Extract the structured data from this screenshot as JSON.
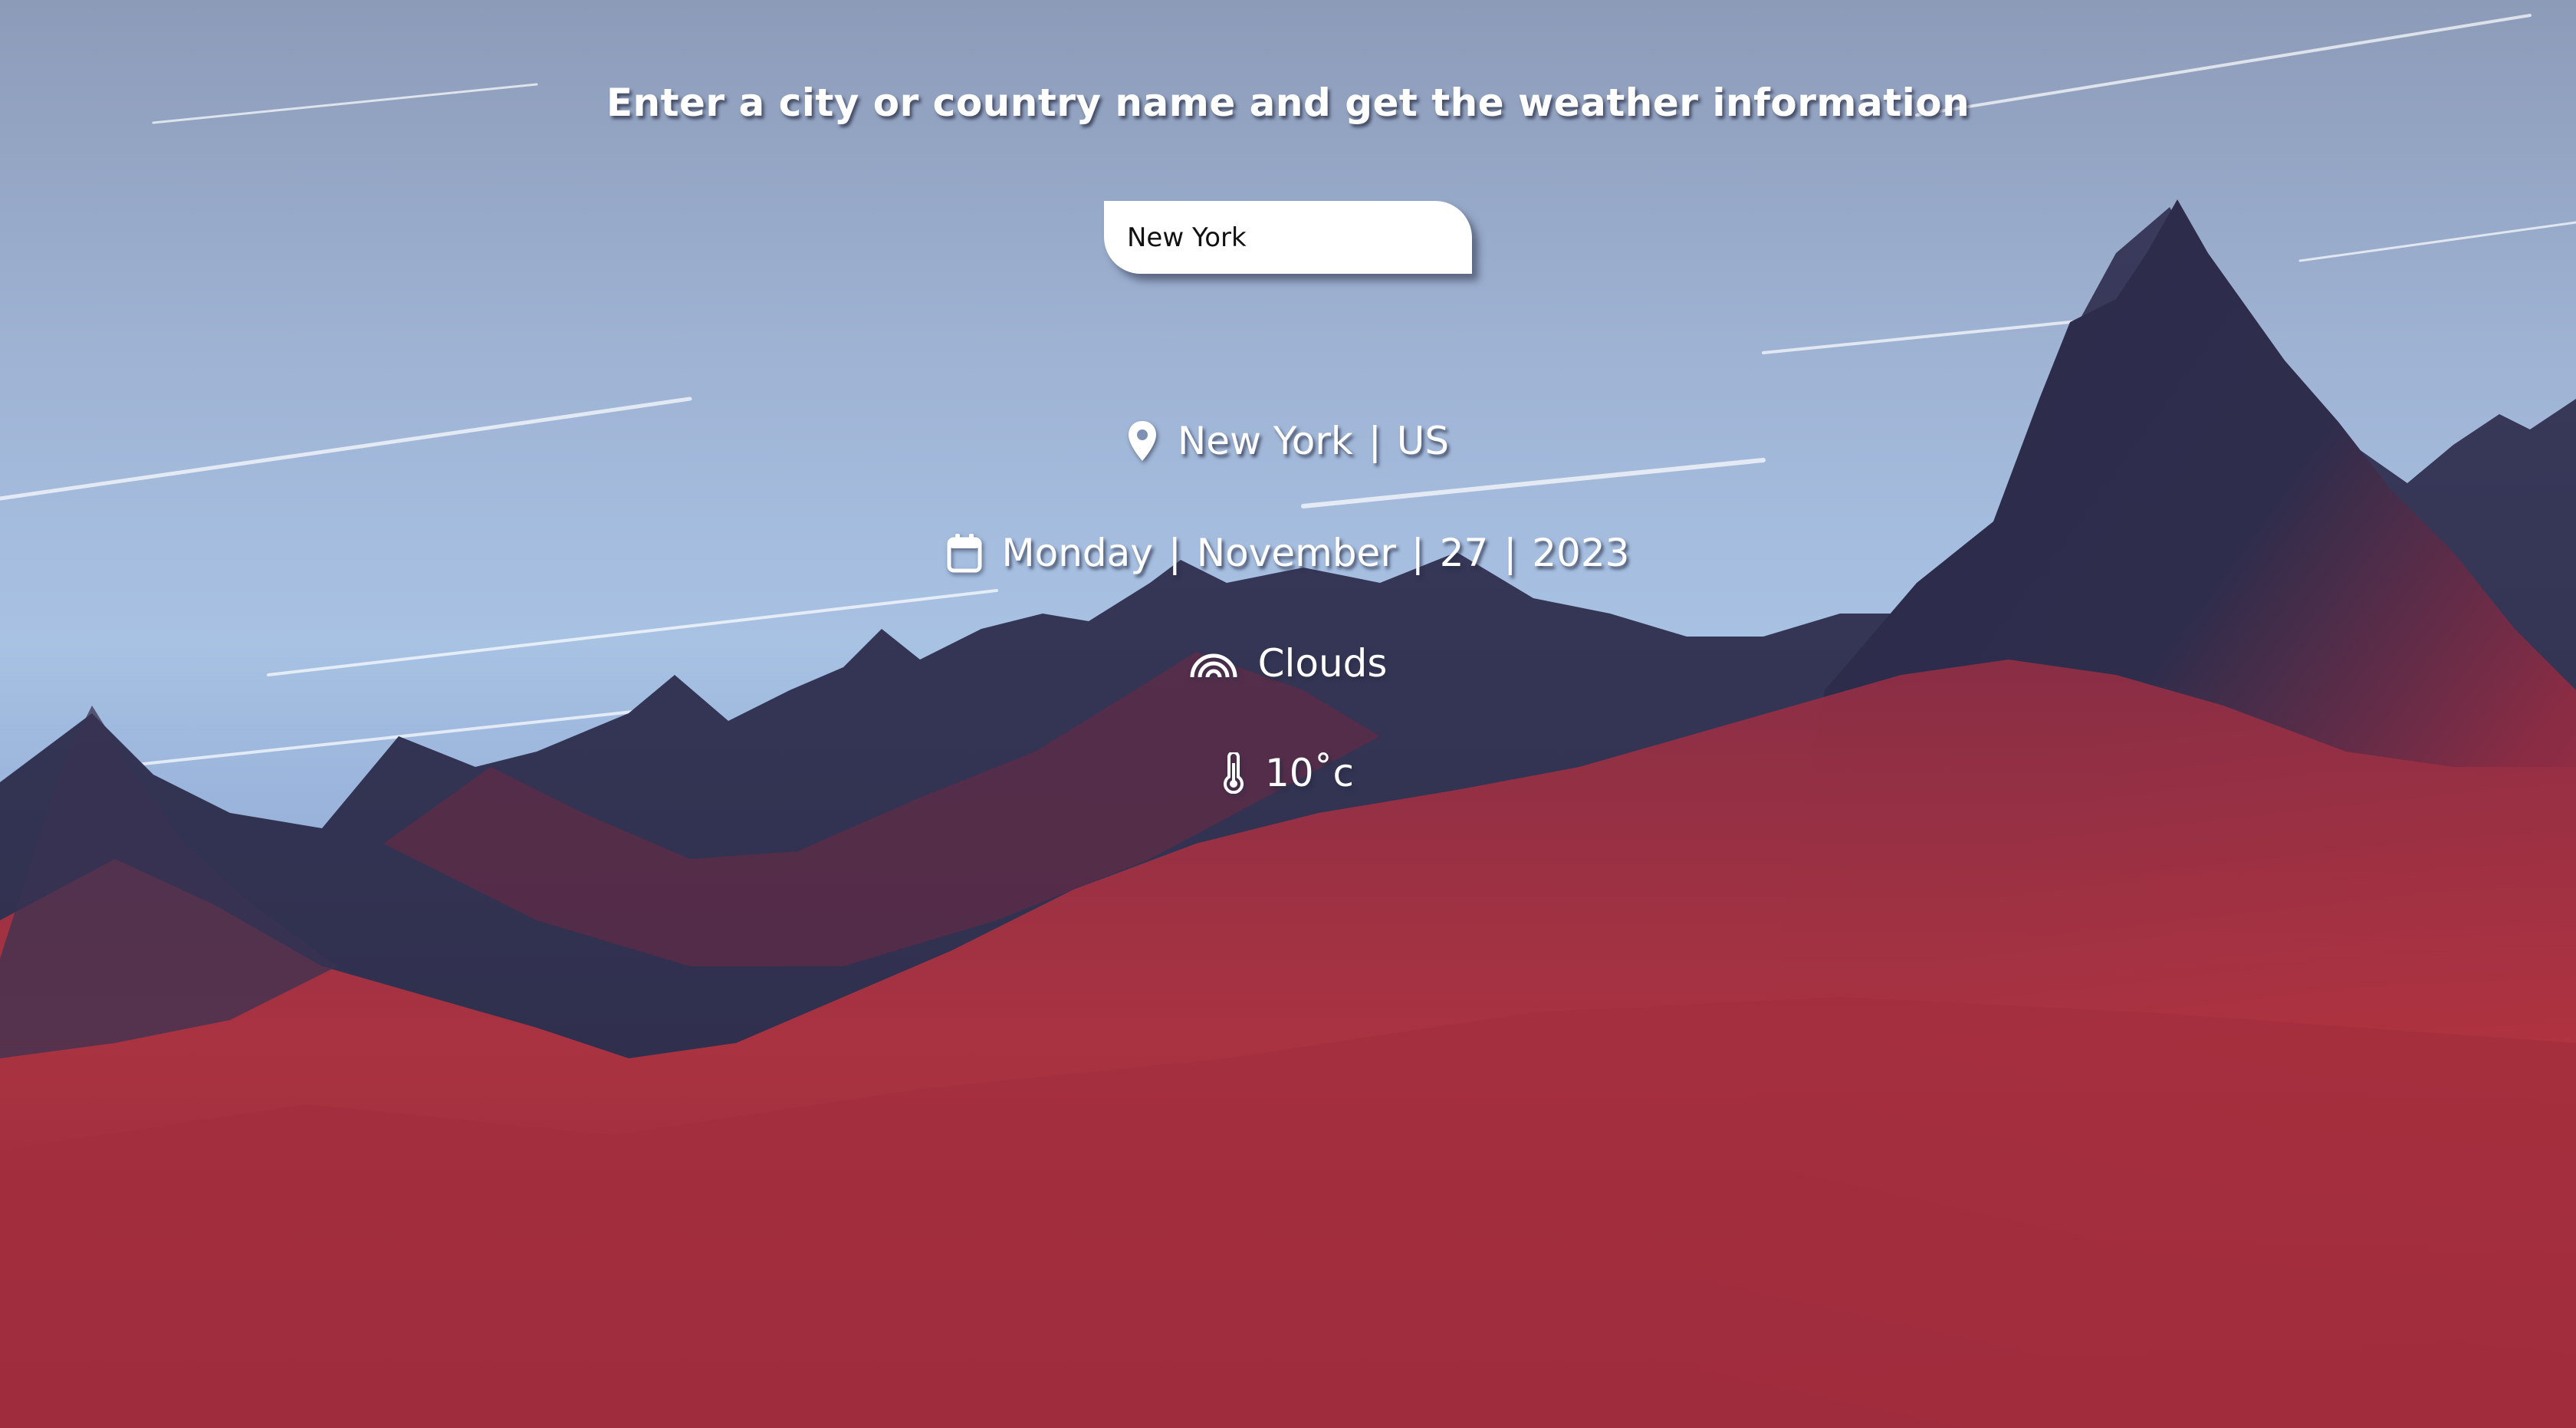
{
  "headline": "Enter a city or country name and get the weather information",
  "search": {
    "value": "New York",
    "placeholder": ""
  },
  "weather": {
    "city": "New York",
    "country": "US",
    "location_separator": "|",
    "date": {
      "weekday": "Monday",
      "month": "November",
      "day": "27",
      "year": "2023",
      "separator": "|"
    },
    "condition": "Clouds",
    "temperature": "10˚c"
  },
  "icons": {
    "location": "map-pin-icon",
    "date": "calendar-icon",
    "condition": "rainbow-icon",
    "temperature": "thermometer-icon"
  },
  "colors": {
    "text": "#ffffff",
    "input_bg": "#ffffff",
    "mountain_red": "#a8303f",
    "mountain_dark": "#2e2e4e",
    "sky": "#a8c2e4"
  }
}
